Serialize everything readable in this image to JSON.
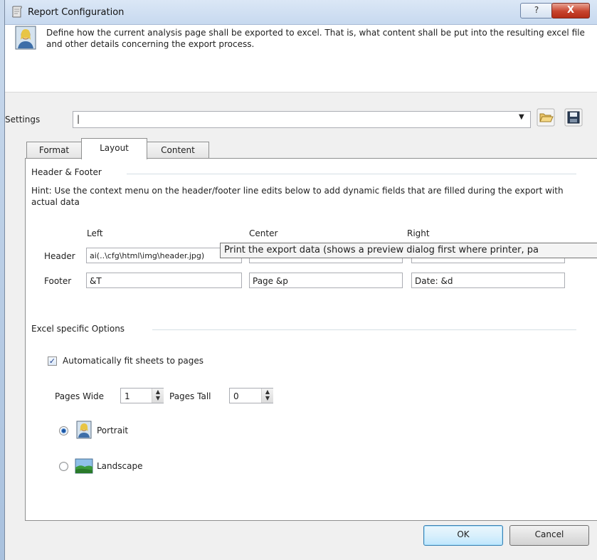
{
  "window": {
    "title": "Report Configuration",
    "help_label": "?",
    "close_label": "X"
  },
  "header": {
    "description": "Define how the current analysis page shall be exported to excel. That is, what content shall be put into the resulting excel file and other details concerning the export process."
  },
  "settings": {
    "label": "Settings",
    "value": "|"
  },
  "tabs": [
    {
      "label": "Format"
    },
    {
      "label": "Layout"
    },
    {
      "label": "Content"
    }
  ],
  "layout": {
    "header_footer_group": "Header & Footer",
    "hint": "Hint: Use the context menu on the header/footer line edits below to add dynamic fields that are filled during the export with actual data",
    "col_left": "Left",
    "col_center": "Center",
    "col_right": "Right",
    "header_label": "Header",
    "footer_label": "Footer",
    "header_left": "ai(..\\cfg\\html\\img\\header.jpg)",
    "header_center": "",
    "header_right": "",
    "footer_left": "&T",
    "footer_center": "Page &p",
    "footer_right": "Date: &d",
    "tooltip": "Print the export data (shows a preview dialog first where printer, pa",
    "excel_group": "Excel specific Options",
    "autofit_label": "Automatically fit sheets to pages",
    "autofit_checked": true,
    "pages_wide_label": "Pages Wide",
    "pages_wide_value": "1",
    "pages_tall_label": "Pages Tall",
    "pages_tall_value": "0",
    "portrait_label": "Portrait",
    "landscape_label": "Landscape",
    "orientation": "Portrait"
  },
  "buttons": {
    "ok": "OK",
    "cancel": "Cancel"
  },
  "icons": {
    "title": "report-icon",
    "header": "user-portrait-icon",
    "folder": "folder-open-icon",
    "save": "floppy-disk-icon",
    "portrait": "portrait-icon",
    "landscape": "landscape-icon"
  }
}
